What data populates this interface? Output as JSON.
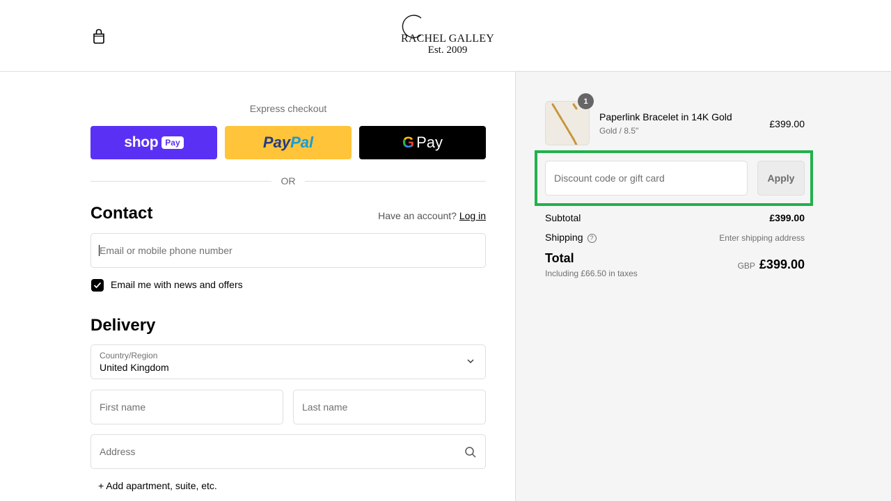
{
  "header": {
    "logo_name": "RACHEL GALLEY",
    "logo_est": "Est. 2009"
  },
  "express": {
    "title": "Express checkout",
    "shop_label": "shop",
    "shop_pay_label": "Pay",
    "paypal_label_1": "Pay",
    "paypal_label_2": "Pal",
    "gpay_g": "G",
    "gpay_label": "Pay",
    "or_label": "OR"
  },
  "contact": {
    "title": "Contact",
    "have_account": "Have an account?",
    "login_label": "Log in",
    "email_placeholder": "Email or mobile phone number",
    "newsletter_label": "Email me with news and offers",
    "newsletter_checked": true
  },
  "delivery": {
    "title": "Delivery",
    "country_label": "Country/Region",
    "country_value": "United Kingdom",
    "first_name_placeholder": "First name",
    "last_name_placeholder": "Last name",
    "address_placeholder": "Address",
    "add_apartment": "+ Add apartment, suite, etc."
  },
  "summary": {
    "product": {
      "quantity": "1",
      "name": "Paperlink Bracelet in 14K Gold",
      "variant": "Gold / 8.5\"",
      "price": "£399.00"
    },
    "discount_placeholder": "Discount code or gift card",
    "apply_label": "Apply",
    "subtotal_label": "Subtotal",
    "subtotal_value": "£399.00",
    "shipping_label": "Shipping",
    "shipping_value": "Enter shipping address",
    "total_label": "Total",
    "tax_note": "Including £66.50 in taxes",
    "currency": "GBP",
    "total_value": "£399.00"
  },
  "colors": {
    "shop_pay": "#5a31f4",
    "paypal": "#ffc439",
    "gpay": "#000000",
    "highlight": "#22b14c"
  }
}
